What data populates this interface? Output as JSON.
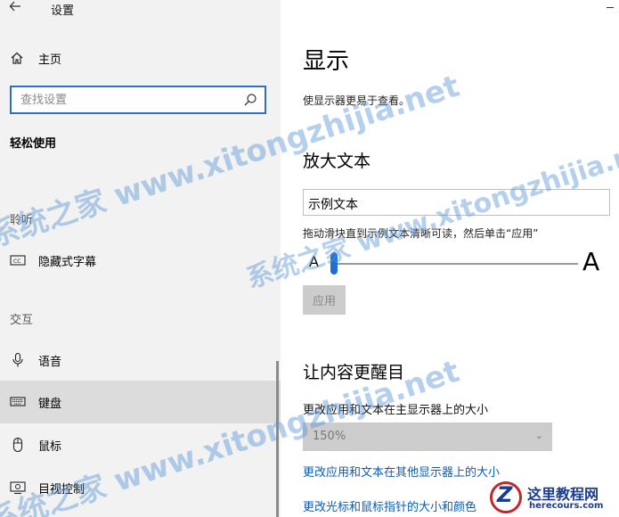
{
  "window": {
    "title": "设置"
  },
  "sidebar": {
    "home_label": "主页",
    "search_placeholder": "查找设置",
    "section_title": "轻松使用",
    "groups": [
      {
        "label": "聆听"
      },
      {
        "label": "交互"
      }
    ],
    "items": [
      {
        "label": "隐藏式字幕",
        "icon": "closed-captions-icon"
      },
      {
        "label": "语音",
        "icon": "microphone-icon"
      },
      {
        "label": "键盘",
        "icon": "keyboard-icon",
        "active": true
      },
      {
        "label": "鼠标",
        "icon": "mouse-icon"
      },
      {
        "label": "目视控制",
        "icon": "eye-control-icon"
      }
    ]
  },
  "main": {
    "title": "显示",
    "subtitle": "使显示器更易于查看。",
    "text_size": {
      "heading": "放大文本",
      "sample": "示例文本",
      "hint": "拖动滑块直到示例文本清晰可读，然后单击“应用”",
      "small_a": "A",
      "big_a": "A",
      "slider_value_pct": 0,
      "apply_label": "应用"
    },
    "emphasis": {
      "heading": "让内容更醒目",
      "scale_label": "更改应用和文本在主显示器上的大小",
      "scale_value": "150%",
      "link_other_displays": "更改应用和文本在其他显示器上的大小",
      "link_pointer": "更改光标和鼠标指针的大小和颜色"
    }
  },
  "watermark": {
    "text": "系统之家 www.xitongzhijia.net",
    "color": "#5a96d7"
  },
  "logo": {
    "letter": "Z",
    "name": "这里教程网",
    "url": "herecours.com"
  },
  "colors": {
    "accent": "#1f6fd1",
    "link": "#0a5cb8",
    "sidebar_bg": "#f2f2f2"
  }
}
